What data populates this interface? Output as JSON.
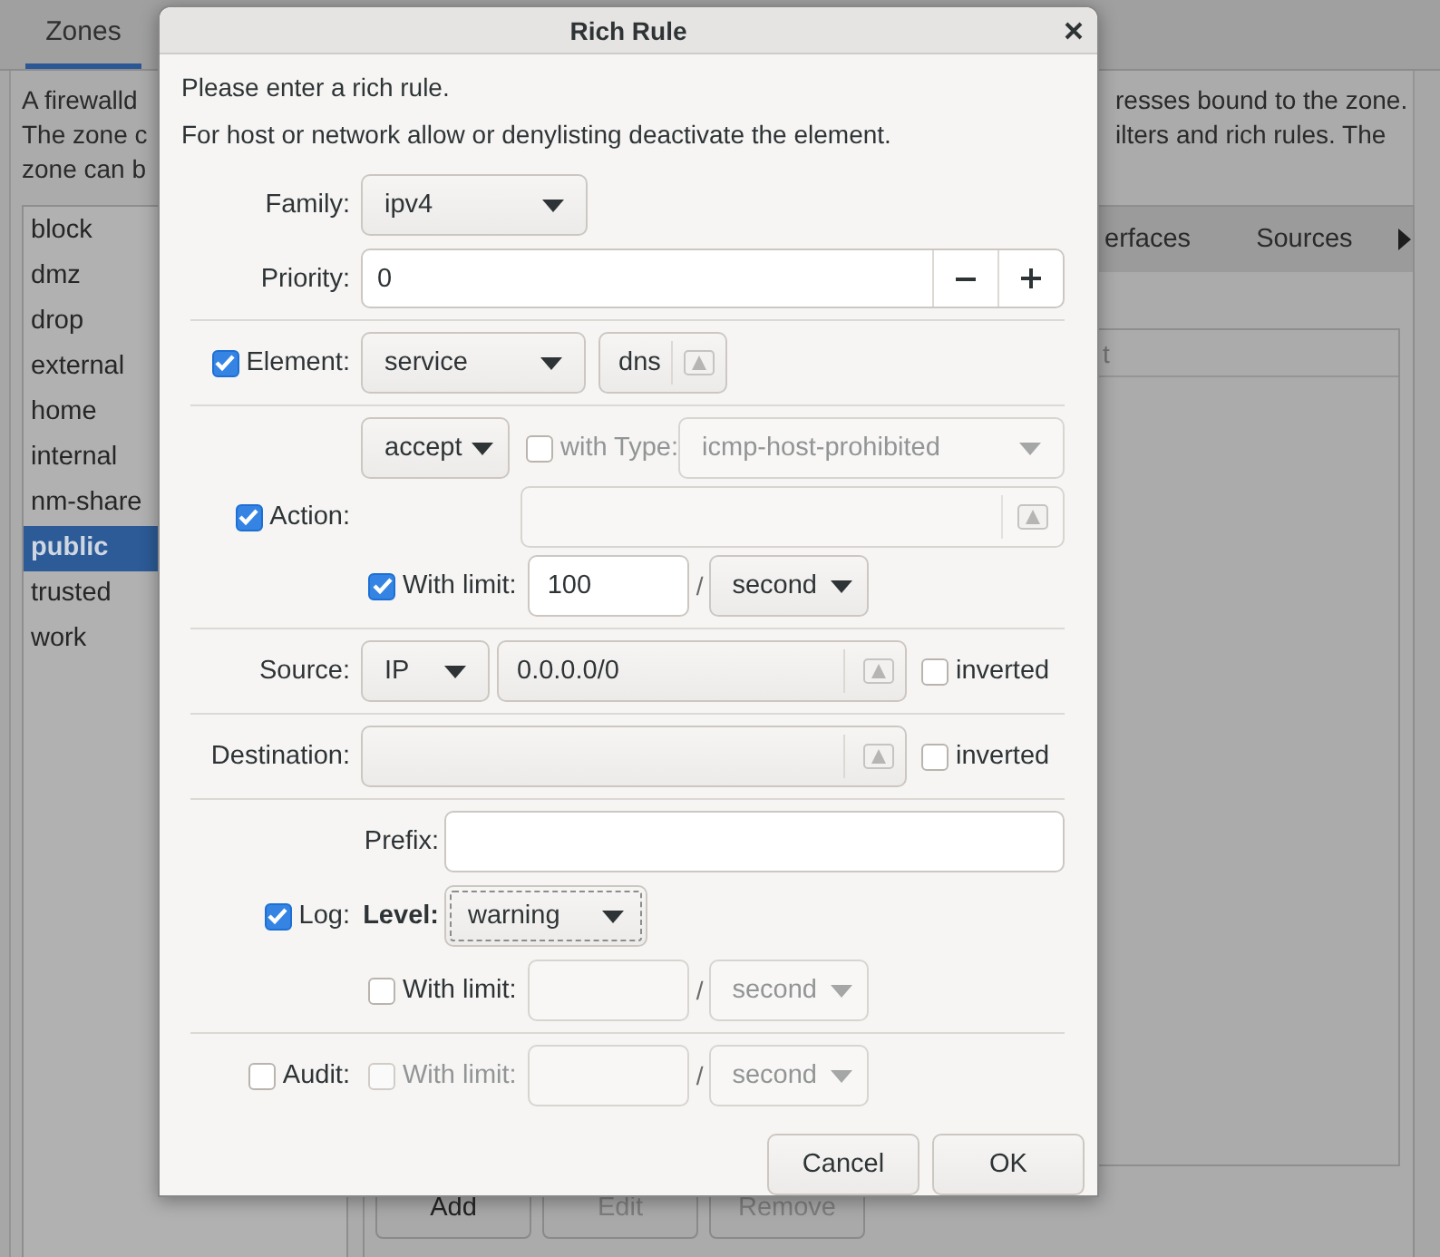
{
  "main_window": {
    "tabs": [
      {
        "label": "Zones",
        "selected": true
      }
    ],
    "description_left": [
      "A firewalld",
      "The zone c",
      "zone can b"
    ],
    "description_right": [
      "resses bound to the zone.",
      "ilters and rich rules. The"
    ],
    "zones": [
      {
        "name": "block",
        "selected": false
      },
      {
        "name": "dmz",
        "selected": false
      },
      {
        "name": "drop",
        "selected": false
      },
      {
        "name": "external",
        "selected": false
      },
      {
        "name": "home",
        "selected": false
      },
      {
        "name": "internal",
        "selected": false
      },
      {
        "name": "nm-share",
        "selected": false
      },
      {
        "name": "public",
        "selected": true
      },
      {
        "name": "trusted",
        "selected": false
      },
      {
        "name": "work",
        "selected": false
      }
    ],
    "detail_tabs": [
      {
        "label": "erfaces"
      },
      {
        "label": "Sources"
      }
    ],
    "table": {
      "columns": [
        "t"
      ]
    },
    "buttons": [
      {
        "label": "Add",
        "disabled": false
      },
      {
        "label": "Edit",
        "disabled": true
      },
      {
        "label": "Remove",
        "disabled": true
      }
    ]
  },
  "dialog": {
    "title": "Rich Rule",
    "intro": [
      "Please enter a rich rule.",
      "For host or network allow or denylisting deactivate the element."
    ],
    "family": {
      "label": "Family:",
      "value": "ipv4"
    },
    "priority": {
      "label": "Priority:",
      "value": "0"
    },
    "element": {
      "label": "Element:",
      "checked": true,
      "type": "service",
      "value": "dns"
    },
    "action": {
      "label": "Action:",
      "checked": true,
      "value": "accept",
      "with_type": {
        "label": "with Type:",
        "checked": false,
        "value": "icmp-host-prohibited"
      },
      "limit": {
        "label": "With limit:",
        "checked": true,
        "value": "100",
        "separator": "/",
        "unit": "second"
      }
    },
    "source": {
      "label": "Source:",
      "type": "IP",
      "value": "0.0.0.0/0",
      "inverted": {
        "label": "inverted",
        "checked": false
      }
    },
    "destination": {
      "label": "Destination:",
      "inverted": {
        "label": "inverted",
        "checked": false
      }
    },
    "log": {
      "label": "Log:",
      "checked": true,
      "prefix_label": "Prefix:",
      "level_label": "Level:",
      "level": "warning",
      "limit": {
        "label": "With limit:",
        "checked": false,
        "separator": "/",
        "unit": "second"
      }
    },
    "audit": {
      "label": "Audit:",
      "checked": false,
      "limit": {
        "label": "With limit:",
        "checked": false,
        "separator": "/",
        "unit": "second"
      }
    },
    "buttons": [
      "Cancel",
      "OK"
    ]
  }
}
